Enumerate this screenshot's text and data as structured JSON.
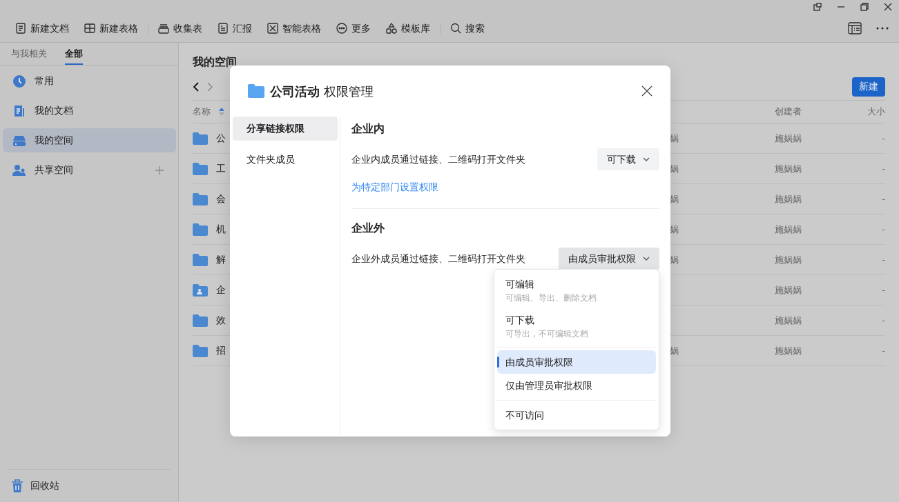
{
  "toolbar_groups": [
    {
      "items": [
        {
          "label": "新建文档",
          "kind": "doc"
        },
        {
          "label": "新建表格",
          "kind": "table"
        }
      ]
    },
    {
      "items": [
        {
          "label": "收集表",
          "kind": "collect"
        },
        {
          "label": "汇报",
          "kind": "report"
        },
        {
          "label": "智能表格",
          "kind": "smart"
        },
        {
          "label": "更多",
          "kind": "more"
        },
        {
          "label": "模板库",
          "kind": "template"
        }
      ]
    },
    {
      "items": [
        {
          "label": "搜索",
          "kind": "search"
        }
      ]
    }
  ],
  "sidebar": {
    "tabs": [
      {
        "label": "与我相关",
        "selected": false
      },
      {
        "label": "全部",
        "selected": true
      }
    ],
    "items": [
      {
        "label": "常用",
        "kind": "recent",
        "selected": false,
        "addable": false
      },
      {
        "label": "我的文档",
        "kind": "docs",
        "selected": false,
        "addable": false
      },
      {
        "label": "我的空间",
        "kind": "space",
        "selected": true,
        "addable": false
      },
      {
        "label": "共享空间",
        "kind": "shared",
        "selected": false,
        "addable": true
      }
    ],
    "trash": "回收站"
  },
  "main": {
    "title": "我的空间",
    "new_button": "新建",
    "columns": {
      "name": "名称",
      "creator": "创建者",
      "size": "大小"
    },
    "rows": [
      {
        "name": "公",
        "kind": "folder",
        "column_3": "娲",
        "creator": "施娲娲",
        "size": "-"
      },
      {
        "name": "工",
        "kind": "folder",
        "column_3": "娲",
        "creator": "施娲娲",
        "size": "-"
      },
      {
        "name": "会",
        "kind": "folder",
        "column_3": "娲",
        "creator": "施娲娲",
        "size": "-"
      },
      {
        "name": "机",
        "kind": "folder",
        "column_3": "娲",
        "creator": "施娲娲",
        "size": "-"
      },
      {
        "name": "解",
        "kind": "folder",
        "column_3": "娲",
        "creator": "施娲娲",
        "size": "-"
      },
      {
        "name": "企",
        "kind": "shared_folder",
        "creator": "施娲娲",
        "size": "-"
      },
      {
        "name": "效",
        "kind": "folder",
        "creator": "施娲娲",
        "size": "-"
      },
      {
        "name": "招",
        "kind": "folder",
        "column_3": "娲",
        "creator": "施娲娲",
        "size": "-"
      }
    ]
  },
  "dialog": {
    "folder_name": "公司活动",
    "title": "权限管理",
    "nav": [
      {
        "label": "分享链接权限",
        "selected": true
      },
      {
        "label": "文件夹成员",
        "selected": false
      }
    ],
    "sections": [
      {
        "heading": "企业内",
        "description": "企业内成员通过链接、二维码打开文件夹",
        "value": "可下载",
        "open": false,
        "link": "为特定部门设置权限"
      },
      {
        "heading": "企业外",
        "description": "企业外成员通过链接、二维码打开文件夹",
        "value": "由成员审批权限",
        "open": true,
        "menu": [
          {
            "items": [
              {
                "label": "可编辑",
                "hint": "可编辑、导出、删除文档",
                "selected": false
              },
              {
                "label": "可下载",
                "hint": "可导出，不可编辑文档",
                "selected": false
              }
            ]
          },
          {
            "items": [
              {
                "label": "由成员审批权限",
                "selected": true
              },
              {
                "label": "仅由管理员审批权限",
                "selected": false
              }
            ]
          },
          {
            "items": [
              {
                "label": "不可访问",
                "selected": false
              }
            ]
          }
        ]
      }
    ]
  }
}
